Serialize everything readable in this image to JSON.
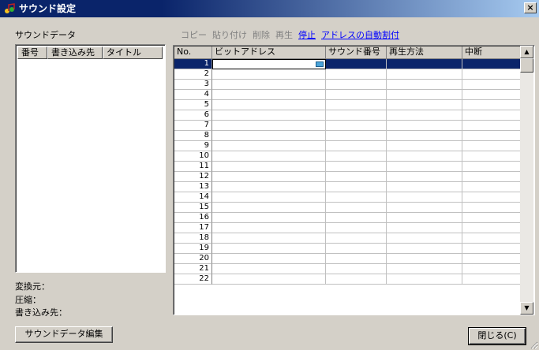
{
  "window": {
    "title": "サウンド設定",
    "close_glyph": "×"
  },
  "left_panel": {
    "heading": "サウンドデータ",
    "columns": [
      "番号",
      "書き込み先",
      "タイトル"
    ],
    "info": {
      "source_label": "変換元：",
      "compression_label": "圧縮：",
      "destination_label": "書き込み先："
    },
    "edit_button": "サウンドデータ編集"
  },
  "toolbar": {
    "copy": "コピー",
    "paste": "貼り付け",
    "delete": "削除",
    "play": "再生",
    "stop": "停止",
    "auto_assign": "アドレスの自動割付"
  },
  "grid": {
    "columns": [
      "No.",
      "ビットアドレス",
      "サウンド番号",
      "再生方法",
      "中断"
    ],
    "rows": [
      "1",
      "2",
      "3",
      "4",
      "5",
      "6",
      "7",
      "8",
      "9",
      "10",
      "11",
      "12",
      "13",
      "14",
      "15",
      "16",
      "17",
      "18",
      "19",
      "20",
      "21",
      "22"
    ],
    "selected_row": 1
  },
  "buttons": {
    "close": "閉じる(C)"
  },
  "colors": {
    "title_bar": "#0a246a",
    "selection": "#0a246a",
    "link": "#0000ff",
    "face": "#d4d0c8"
  }
}
